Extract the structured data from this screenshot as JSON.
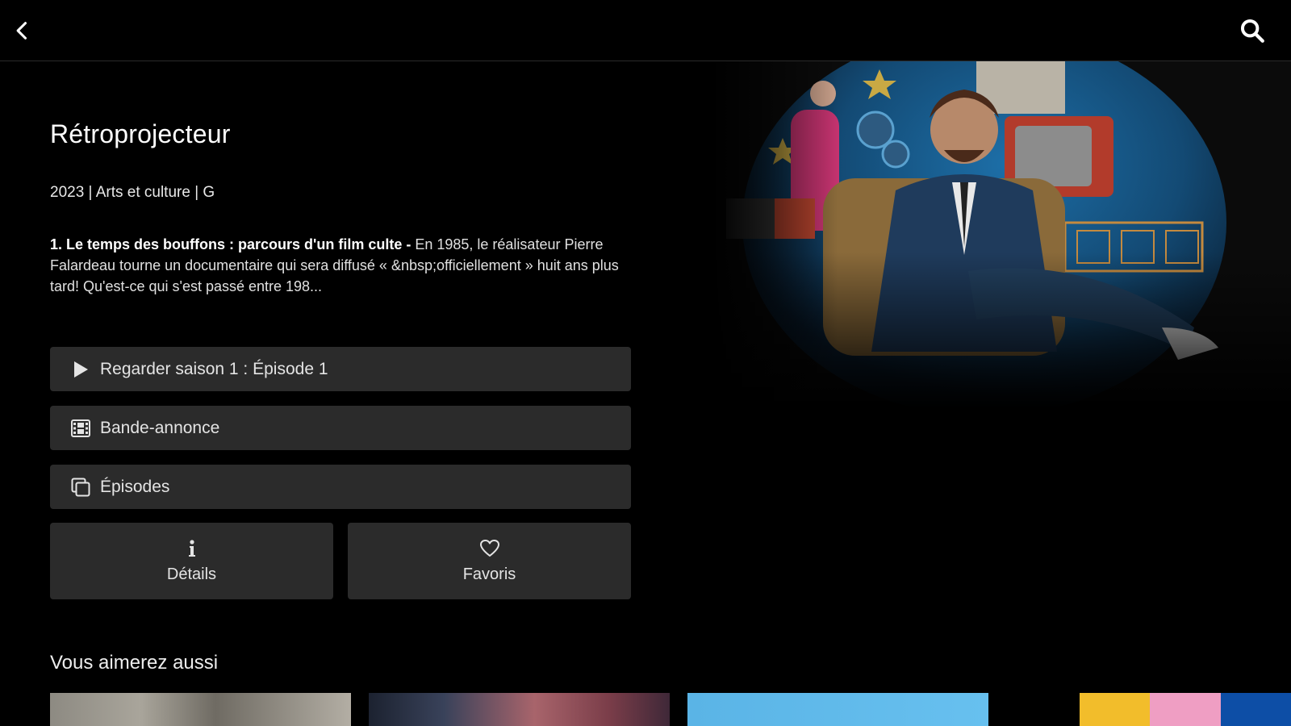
{
  "header": {
    "back_icon": "chevron-left-icon",
    "search_icon": "search-icon"
  },
  "show": {
    "title": "Rétroprojecteur",
    "meta": "2023 | Arts et culture | G",
    "episode_title": "1. Le temps des bouffons : parcours d'un film culte",
    "episode_separator": " - ",
    "episode_description": "En 1985, le réalisateur Pierre Falardeau tourne un documentaire qui sera diffusé « &nbsp;officiellement » huit ans plus tard! Qu'est-ce qui s'est passé entre 198..."
  },
  "actions": {
    "watch_label": "Regarder saison 1 : Épisode 1",
    "trailer_label": "Bande-annonce",
    "episodes_label": "Épisodes",
    "details_label": "Détails",
    "favorites_label": "Favoris"
  },
  "recommendations": {
    "title": "Vous aimerez aussi"
  },
  "colors": {
    "background": "#000000",
    "button": "#2b2b2b",
    "text": "#ffffff"
  }
}
